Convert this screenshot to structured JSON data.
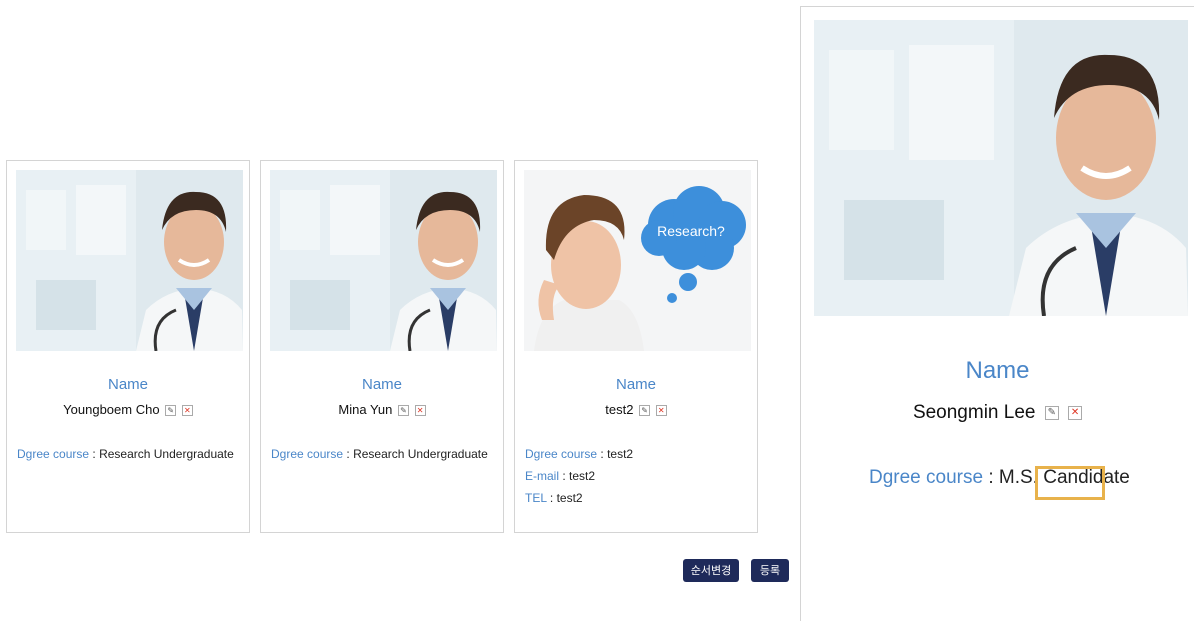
{
  "cards": [
    {
      "name_label": "Name",
      "name": "Youngboem Cho",
      "degree_key": "Dgree course",
      "degree_val": "Research Undergraduate"
    },
    {
      "name_label": "Name",
      "name": "Mina Yun",
      "degree_key": "Dgree course",
      "degree_val": "Research Undergraduate"
    },
    {
      "name_label": "Name",
      "name": "test2",
      "degree_key": "Dgree course",
      "degree_val": "test2",
      "email_key": "E-mail",
      "email_val": "test2",
      "tel_key": "TEL",
      "tel_val": "test2",
      "bubble_text": "Research?"
    }
  ],
  "detail": {
    "name_label": "Name",
    "name": "Seongmin Lee",
    "degree_key": "Dgree course",
    "degree_val": "M.S. Candidate"
  },
  "buttons": {
    "reorder": "순서변경",
    "register": "등록"
  },
  "icons": {
    "edit": "edit-icon",
    "delete": "delete-icon"
  },
  "colors": {
    "accent": "#4a86c8",
    "button": "#1e2a5a",
    "highlight": "#e8b24b"
  }
}
